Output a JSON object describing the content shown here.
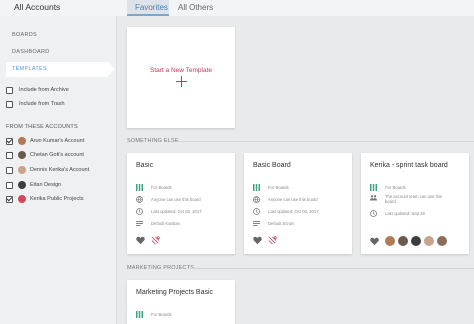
{
  "header": {
    "title": "All Accounts",
    "tabs": [
      {
        "label": "Favorites",
        "active": true
      },
      {
        "label": "All Others",
        "active": false
      }
    ]
  },
  "sidebar": {
    "nav": [
      "BOARDS",
      "DASHBOARD",
      "TEMPLATES"
    ],
    "active_nav": "TEMPLATES",
    "filters": [
      {
        "label": "Include from Archive",
        "checked": false
      },
      {
        "label": "Include from Trash",
        "checked": false
      }
    ],
    "accounts_header": "FROM THESE ACCOUNTS",
    "accounts": [
      {
        "label": "Arun Kumar's Account",
        "checked": true,
        "avatar_color": "#b07a55"
      },
      {
        "label": "Chetan Goti's account",
        "checked": false,
        "avatar_color": "#6b5a4e"
      },
      {
        "label": "Dennis Kerika's Account",
        "checked": false,
        "avatar_color": "#c9a48a"
      },
      {
        "label": "Eitan Design",
        "checked": false,
        "avatar_color": "#3d3d3d"
      },
      {
        "label": "Kerika Public Projects",
        "checked": true,
        "avatar_color": "#d0485a"
      }
    ]
  },
  "main": {
    "new_template": "Start a New Template",
    "sections": [
      {
        "label": "SOMETHING ELSE"
      },
      {
        "label": "MARKETING PROJECTS"
      }
    ],
    "cards": [
      {
        "title": "Basic",
        "meta": [
          "For Boards",
          "Anyone can use this board",
          "Last updated: Oct 03, 2017",
          "Default Kanban"
        ],
        "avatars": []
      },
      {
        "title": "Basic Board",
        "meta": [
          "For Boards",
          "Anyone can use this board",
          "Last updated: Oct 03, 2017",
          "Default Scrum"
        ],
        "avatars": []
      },
      {
        "title": "Kerika - sprint task board",
        "meta": [
          "For Boards",
          "The account team can use this board",
          "Last updated: Sep 28"
        ],
        "avatars": [
          "#b07a55",
          "#6b5a4e",
          "#3d3d3d",
          "#c9a48a",
          "#8a6e5c"
        ]
      },
      {
        "title": "Marketing Projects Basic",
        "meta": [
          "For Boards"
        ],
        "avatars": []
      }
    ]
  },
  "colors": {
    "accent_red": "#c2385a",
    "accent_blue": "#4f9be0",
    "board_icon_green": "#3fa184"
  }
}
